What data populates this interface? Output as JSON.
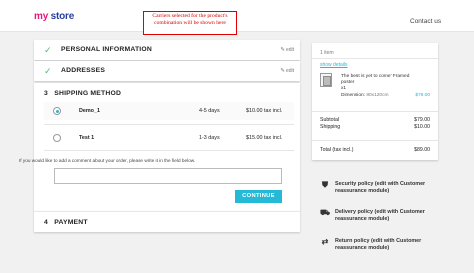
{
  "header": {
    "logo_part1": "my",
    "logo_part2": " store",
    "contact_link": "Contact us"
  },
  "annotation": {
    "text": "Carriers selected for the product's combination will be shown here"
  },
  "steps": {
    "personal": {
      "title": "PERSONAL INFORMATION",
      "edit": "edit",
      "done": true
    },
    "addresses": {
      "title": "ADDRESSES",
      "edit": "edit",
      "done": true
    },
    "shipping": {
      "number": "3",
      "title": "SHIPPING METHOD"
    },
    "payment": {
      "number": "4",
      "title": "PAYMENT"
    }
  },
  "carriers": [
    {
      "name": "Demo_1",
      "delay": "4-5 days",
      "price": "$10.00 tax incl.",
      "selected": true
    },
    {
      "name": "Test 1",
      "delay": "1-3 days",
      "price": "$15.00 tax incl.",
      "selected": false
    }
  ],
  "comment": {
    "label": "If you would like to add a comment about your order, please write it in the field below.",
    "value": ""
  },
  "continue_button": "CONTINUE",
  "summary": {
    "items_count": "1 item",
    "show_details": "show details",
    "product_name": "The best is yet to come' Framed poster",
    "quantity": "x1",
    "dimension_label": "Dimension:",
    "dimension_value": "80x120cm",
    "product_price": "$79.00",
    "subtotal_label": "Subtotal",
    "subtotal_value": "$79.00",
    "shipping_label": "Shipping",
    "shipping_value": "$10.00",
    "total_label": "Total (tax incl.)",
    "total_value": "$89.00"
  },
  "reassurance": [
    {
      "icon": "shield-icon",
      "glyph": "⛊",
      "text": "Security policy (edit with Customer reassurance module)"
    },
    {
      "icon": "truck-icon",
      "glyph": "⛟",
      "text": "Delivery policy (edit with Customer reassurance module)"
    },
    {
      "icon": "return-arrows-icon",
      "glyph": "⇄",
      "text": "Return policy (edit with Customer reassurance module)"
    }
  ],
  "colors": {
    "accent": "#24b9d7",
    "check": "#4cbb6c",
    "annotation_border": "#e00000",
    "logo_pink": "#e8177d",
    "logo_blue": "#2a3f9e"
  }
}
